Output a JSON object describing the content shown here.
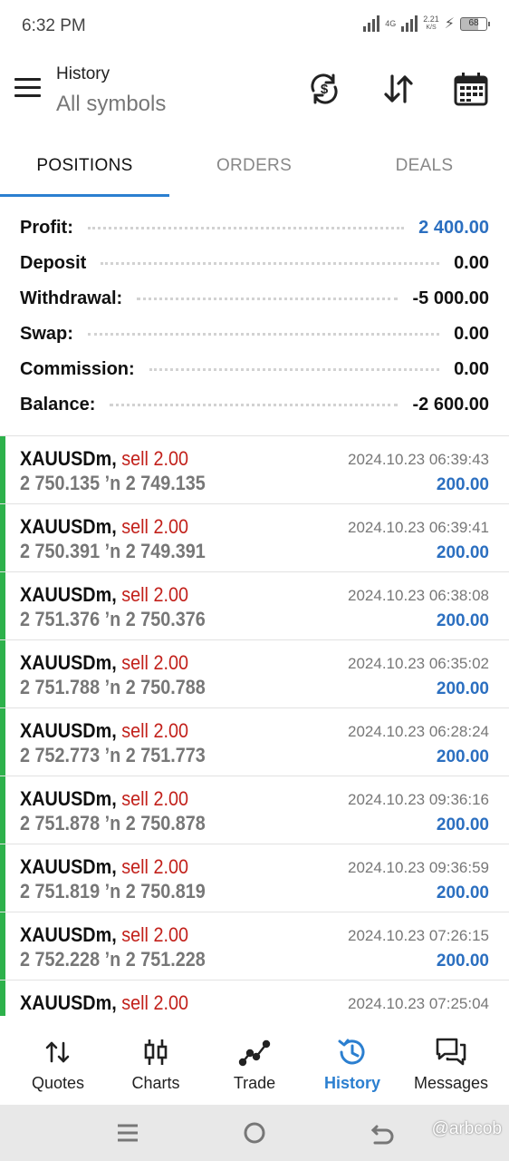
{
  "status_bar": {
    "time": "6:32 PM",
    "network": "4G",
    "speed": "2.21",
    "speed_unit": "K/S",
    "battery": "68"
  },
  "header": {
    "title": "History",
    "subtitle": "All symbols",
    "icons": [
      "currency-refresh-icon",
      "sort-icon",
      "calendar-icon"
    ]
  },
  "tabs": [
    {
      "label": "POSITIONS",
      "active": true
    },
    {
      "label": "ORDERS",
      "active": false
    },
    {
      "label": "DEALS",
      "active": false
    }
  ],
  "summary": [
    {
      "label": "Profit:",
      "value": "2 400.00",
      "highlight": true
    },
    {
      "label": "Deposit",
      "value": "0.00",
      "highlight": false
    },
    {
      "label": "Withdrawal:",
      "value": "-5 000.00",
      "highlight": false
    },
    {
      "label": "Swap:",
      "value": "0.00",
      "highlight": false
    },
    {
      "label": "Commission:",
      "value": "0.00",
      "highlight": false
    },
    {
      "label": "Balance:",
      "value": "-2 600.00",
      "highlight": false
    }
  ],
  "deals": [
    {
      "symbol": "XAUUSDm,",
      "side": "sell 2.00",
      "open": "2 750.135",
      "arrow": "’n",
      "close": "2 749.135",
      "time": "2024.10.23 06:39:43",
      "profit": "200.00"
    },
    {
      "symbol": "XAUUSDm,",
      "side": "sell 2.00",
      "open": "2 750.391",
      "arrow": "’n",
      "close": "2 749.391",
      "time": "2024.10.23 06:39:41",
      "profit": "200.00"
    },
    {
      "symbol": "XAUUSDm,",
      "side": "sell 2.00",
      "open": "2 751.376",
      "arrow": "’n",
      "close": "2 750.376",
      "time": "2024.10.23 06:38:08",
      "profit": "200.00"
    },
    {
      "symbol": "XAUUSDm,",
      "side": "sell 2.00",
      "open": "2 751.788",
      "arrow": "’n",
      "close": "2 750.788",
      "time": "2024.10.23 06:35:02",
      "profit": "200.00"
    },
    {
      "symbol": "XAUUSDm,",
      "side": "sell 2.00",
      "open": "2 752.773",
      "arrow": "’n",
      "close": "2 751.773",
      "time": "2024.10.23 06:28:24",
      "profit": "200.00"
    },
    {
      "symbol": "XAUUSDm,",
      "side": "sell 2.00",
      "open": "2 751.878",
      "arrow": "’n",
      "close": "2 750.878",
      "time": "2024.10.23 09:36:16",
      "profit": "200.00"
    },
    {
      "symbol": "XAUUSDm,",
      "side": "sell 2.00",
      "open": "2 751.819",
      "arrow": "’n",
      "close": "2 750.819",
      "time": "2024.10.23 09:36:59",
      "profit": "200.00"
    },
    {
      "symbol": "XAUUSDm,",
      "side": "sell 2.00",
      "open": "2 752.228",
      "arrow": "’n",
      "close": "2 751.228",
      "time": "2024.10.23 07:26:15",
      "profit": "200.00"
    },
    {
      "symbol": "XAUUSDm,",
      "side": "sell 2.00",
      "open": "",
      "arrow": "",
      "close": "",
      "time": "2024.10.23 07:25:04",
      "profit": ""
    }
  ],
  "bottom_nav": [
    {
      "label": "Quotes",
      "icon": "quotes-icon",
      "active": false
    },
    {
      "label": "Charts",
      "icon": "charts-icon",
      "active": false
    },
    {
      "label": "Trade",
      "icon": "trade-icon",
      "active": false
    },
    {
      "label": "History",
      "icon": "history-icon",
      "active": true
    },
    {
      "label": "Messages",
      "icon": "messages-icon",
      "active": false
    }
  ],
  "watermark": "@arbcob",
  "colors": {
    "accent": "#2b7fd0",
    "profit_blue": "#2b6fc0",
    "sell_red": "#c2201a",
    "deal_bar_green": "#2db14b"
  }
}
